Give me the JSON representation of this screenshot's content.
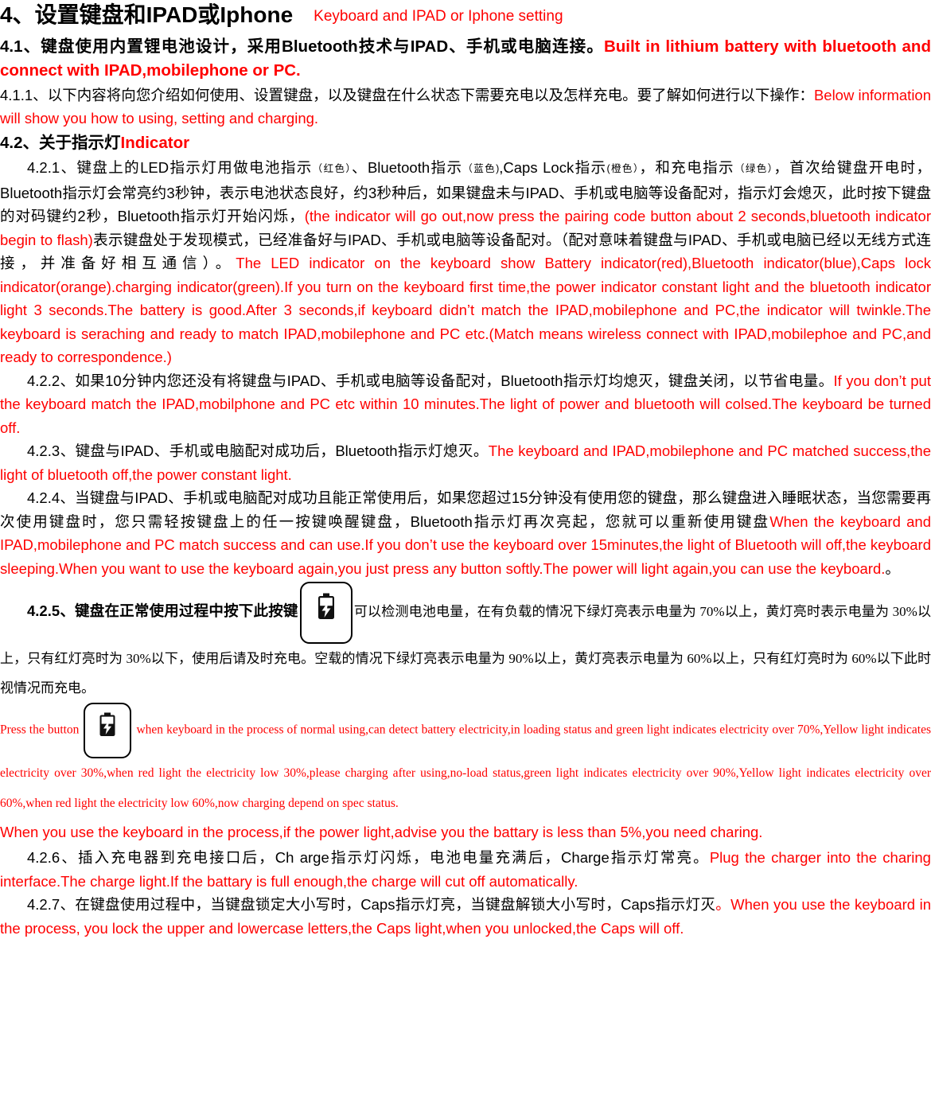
{
  "document": {
    "title_cn": "4、设置键盘和IPAD或Iphone",
    "title_en": "Keyboard and IPAD or Iphone setting",
    "accent_red": "#ff0000",
    "text_color": "#000000"
  },
  "sections": {
    "s41": {
      "cn": "4.1、键盘使用内置锂电池设计，采用Bluetooth技术与IPAD、手机或电脑连接。",
      "en": "Built in lithium battery with bluetooth and connect with IPAD,mobilephone or PC."
    },
    "s411": {
      "cn": "4.1.1、以下内容将向您介绍如何使用、设置键盘，以及键盘在什么状态下需要充电以及怎样充电。要了解如何进行以下操作：",
      "en": "Below information will show you how to using, setting and charging."
    },
    "s42": {
      "cn": "4.2、关于指示灯",
      "en": "Indicator"
    },
    "s421": {
      "cn_a": "4.2.1、键盘上的LED指示灯用做电池指示",
      "note_red": "（红色）",
      "cn_b": "、Bluetooth指示",
      "note_blue": "（蓝色)",
      "cn_c": ",Caps Lock指示",
      "note_orange": "(橙色）",
      "cn_d": "，和充电指示",
      "note_green": "（绿色）",
      "cn_e": "，首次给键盘开电时，Bluetooth指示灯会常亮约3秒钟，表示电池状态良好，约3秒种后，如果键盘未与IPAD、手机或电脑等设备配对，指示灯会熄灭，此时按下键盘的对码键约2秒，Bluetooth指示灯开始闪烁，",
      "en_mid": "(the indicator will go out,now press the pairing code button about 2 seconds,bluetooth indicator begin to flash)",
      "cn_f": "表示键盘处于发现模式，已经准备好与IPAD、手机或电脑等设备配对。（配对意味着键盘与IPAD、手机或电脑已经以无线方式连接，并准备好相互通信）。",
      "en_tail": "The LED indicator on the keyboard show Battery indicator(red),Bluetooth indicator(blue),Caps lock indicator(orange).charging indicator(green).If you turn on the keyboard first time,the power indicator constant light and the bluetooth indicator light 3 seconds.The battery is good.After 3 seconds,if keyboard didn’t match the IPAD,mobilephone and PC,the indicator will twinkle.The keyboard is seraching and ready to match IPAD,mobilephone and PC etc.(Match means wireless connect with IPAD,mobilephoe and PC,and ready to correspondence.)"
    },
    "s422": {
      "cn": "4.2.2、如果10分钟内您还没有将键盘与IPAD、手机或电脑等设备配对，Bluetooth指示灯均熄灭，键盘关闭，以节省电量。",
      "en": "If you don’t put the keyboard match the IPAD,mobilphone and PC etc within 10 minutes.The light of power and bluetooth will colsed.The keyboard be turned off."
    },
    "s423": {
      "cn": "4.2.3、键盘与IPAD、手机或电脑配对成功后，Bluetooth指示灯熄灭。",
      "en": "The keyboard and IPAD,mobilephone and PC matched success,the light of bluetooth off,the power constant light."
    },
    "s424": {
      "cn": "4.2.4、当键盘与IPAD、手机或电脑配对成功且能正常使用后，如果您超过15分钟没有使用您的键盘，那么键盘进入睡眠状态，当您需要再次使用键盘时，您只需轻按键盘上的任一按键唤醒键盘，Bluetooth指示灯再次亮起，您就可以重新使用键盘",
      "en": "When the keyboard and IPAD,mobilephone and PC match success and can use.If you don’t use the keyboard over 15minutes,the light of Bluetooth will off,the keyboard sleeping.When you want to use the keyboard again,you just press any button softly.The power will light again,you can use the keyboard.",
      "tail_cn": "。"
    },
    "s425": {
      "lead": "4.2.5、键盘在正常使用过程中按下此按键",
      "icon_name": "battery-charge-key-icon",
      "cn_rest": "可以检测电池电量，在有负载的情况下绿灯亮表示电量为 70%以上，黄灯亮时表示电量为 30%以上，只有红灯亮时为 30%以下，使用后请及时充电。空载的情况下绿灯亮表示电量为 90%以上，黄灯亮表示电量为 60%以上，只有红灯亮时为 60%以下此时视情况而充电。"
    },
    "s425_en": {
      "pre": "Press the button",
      "icon_name": "battery-charge-key-icon",
      "post": "when keyboard in the process of normal using,can detect battery electricity,in loading status and green light indicates electricity over 70%,Yellow light indicates electricity over 30%,when red light the electricity low 30%,please charging after using,no-load status,green light indicates electricity over 90%,Yellow light indicates electricity over 60%,when red light the electricity low 60%,now charging depend on spec status.",
      "bold_line": "When you use the keyboard in the process,if the power light,advise you the battary is less than 5%,you need charing."
    },
    "s426": {
      "cn": "4.2.6、插入充电器到充电接口后，Ch arge指示灯闪烁，电池电量充满后，Charge指示灯常亮。",
      "en": "Plug the charger into the charing interface.The charge light.If the battary is full enough,the charge will cut off automatically."
    },
    "s427": {
      "cn": "4.2.7、在键盘使用过程中，当键盘锁定大小写时，Caps指示灯亮，当键盘解锁大小写时，Caps指示灯灭",
      "cn_tail": "。",
      "en": "When you use the keyboard in the process, you lock the upper and lowercase letters,the Caps light,when you unlocked,the Caps will off."
    }
  }
}
